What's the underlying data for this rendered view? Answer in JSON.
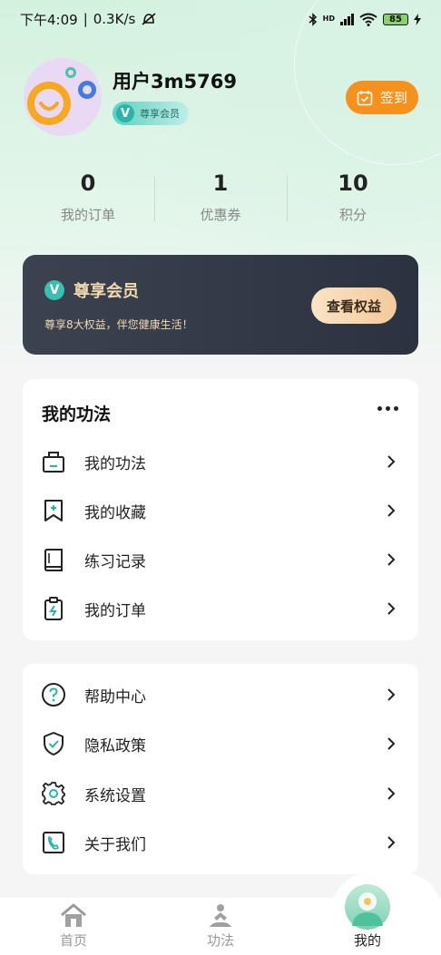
{
  "status_bar": {
    "time": "下午4:09",
    "net_speed": "0.3K/s",
    "hd_label": "HD",
    "battery": "85"
  },
  "profile": {
    "username": "用户3m5769",
    "vip_badge": "尊享会员",
    "vip_letter": "V",
    "signin_label": "签到"
  },
  "stats": [
    {
      "value": "0",
      "label": "我的订单"
    },
    {
      "value": "1",
      "label": "优惠券"
    },
    {
      "value": "10",
      "label": "积分"
    }
  ],
  "vip_card": {
    "letter": "V",
    "title": "尊享会员",
    "subtitle": "尊享8大权益，伴您健康生活！",
    "button": "查看权益"
  },
  "section_main": {
    "title": "我的功法",
    "items": [
      {
        "label": "我的功法",
        "icon": "bag-icon"
      },
      {
        "label": "我的收藏",
        "icon": "bookmark-icon"
      },
      {
        "label": "练习记录",
        "icon": "book-icon"
      },
      {
        "label": "我的订单",
        "icon": "clipboard-icon"
      }
    ]
  },
  "section_other": {
    "items": [
      {
        "label": "帮助中心",
        "icon": "help-icon"
      },
      {
        "label": "隐私政策",
        "icon": "shield-icon"
      },
      {
        "label": "系统设置",
        "icon": "gear-icon"
      },
      {
        "label": "关于我们",
        "icon": "phone-icon"
      }
    ]
  },
  "tabbar": {
    "tabs": [
      {
        "label": "首页",
        "icon": "home-icon"
      },
      {
        "label": "功法",
        "icon": "meditation-icon"
      },
      {
        "label": "我的",
        "icon": "profile-icon"
      }
    ]
  },
  "colors": {
    "accent": "#2bb5a6",
    "signin": "#f5921d",
    "vip_card_bg": "#2f3644",
    "vip_gold": "#f3d9b0"
  }
}
